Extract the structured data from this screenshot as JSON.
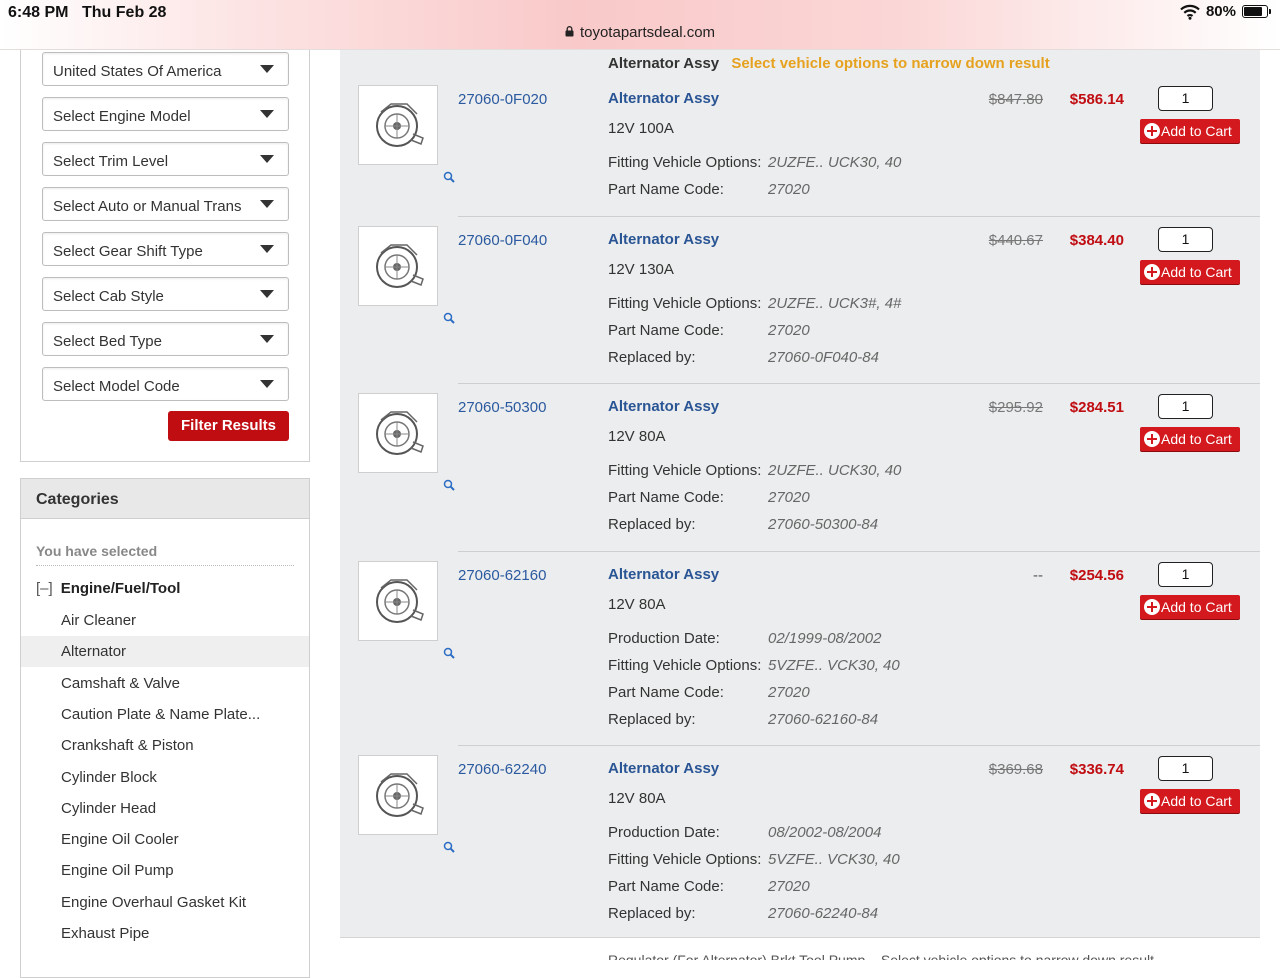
{
  "statusbar": {
    "time": "6:48 PM",
    "date": "Thu Feb 28",
    "url": "toyotapartsdeal.com",
    "battery": "80%",
    "battery_level": 0.8
  },
  "filters": {
    "selects": [
      "United States Of America",
      "Select Engine Model",
      "Select Trim Level",
      "Select Auto or Manual Trans",
      "Select Gear Shift Type",
      "Select Cab Style",
      "Select Bed Type",
      "Select Model Code"
    ],
    "filter_button": "Filter Results"
  },
  "categories": {
    "heading": "Categories",
    "you_selected": "You have selected",
    "toggle": "[–]",
    "parent": "Engine/Fuel/Tool",
    "items": [
      "Air Cleaner",
      "Alternator",
      "Camshaft & Valve",
      "Caution Plate & Name Plate...",
      "Crankshaft & Piston",
      "Cylinder Block",
      "Cylinder Head",
      "Engine Oil Cooler",
      "Engine Oil Pump",
      "Engine Overhaul Gasket Kit",
      "Exhaust Pipe"
    ],
    "active": "Alternator"
  },
  "results": {
    "heading": "Alternator Assy",
    "hint": "Select vehicle options to narrow down result",
    "cart_label": "Add to Cart",
    "products": [
      {
        "part_no": "27060-0F020",
        "name": "Alternator Assy",
        "spec": "12V 100A",
        "old_price": "$847.80",
        "price": "$586.14",
        "qty": "1",
        "attrs": [
          {
            "label": "Fitting Vehicle Options:",
            "value": "2UZFE.. UCK30, 40"
          },
          {
            "label": "Part Name Code:",
            "value": "27020"
          }
        ]
      },
      {
        "part_no": "27060-0F040",
        "name": "Alternator Assy",
        "spec": "12V 130A",
        "old_price": "$440.67",
        "price": "$384.40",
        "qty": "1",
        "attrs": [
          {
            "label": "Fitting Vehicle Options:",
            "value": "2UZFE.. UCK3#, 4#"
          },
          {
            "label": "Part Name Code:",
            "value": "27020"
          },
          {
            "label": "Replaced by:",
            "value": "27060-0F040-84"
          }
        ]
      },
      {
        "part_no": "27060-50300",
        "name": "Alternator Assy",
        "spec": "12V 80A",
        "old_price": "$295.92",
        "price": "$284.51",
        "qty": "1",
        "attrs": [
          {
            "label": "Fitting Vehicle Options:",
            "value": "2UZFE.. UCK30, 40"
          },
          {
            "label": "Part Name Code:",
            "value": "27020"
          },
          {
            "label": "Replaced by:",
            "value": "27060-50300-84"
          }
        ]
      },
      {
        "part_no": "27060-62160",
        "name": "Alternator Assy",
        "spec": "12V 80A",
        "old_price": "--",
        "price": "$254.56",
        "qty": "1",
        "attrs": [
          {
            "label": "Production Date:",
            "value": "02/1999-08/2002"
          },
          {
            "label": "Fitting Vehicle Options:",
            "value": "5VZFE.. VCK30, 40"
          },
          {
            "label": "Part Name Code:",
            "value": "27020"
          },
          {
            "label": "Replaced by:",
            "value": "27060-62160-84"
          }
        ]
      },
      {
        "part_no": "27060-62240",
        "name": "Alternator Assy",
        "spec": "12V 80A",
        "old_price": "$369.68",
        "price": "$336.74",
        "qty": "1",
        "attrs": [
          {
            "label": "Production Date:",
            "value": "08/2002-08/2004"
          },
          {
            "label": "Fitting Vehicle Options:",
            "value": "5VZFE.. VCK30, 40"
          },
          {
            "label": "Part Name Code:",
            "value": "27020"
          },
          {
            "label": "Replaced by:",
            "value": "27060-62240-84"
          }
        ]
      }
    ]
  },
  "next_row_partial": "Regulator (For Alternator) Brkt Tool Pump...  Select vehicle options to narrow down result"
}
